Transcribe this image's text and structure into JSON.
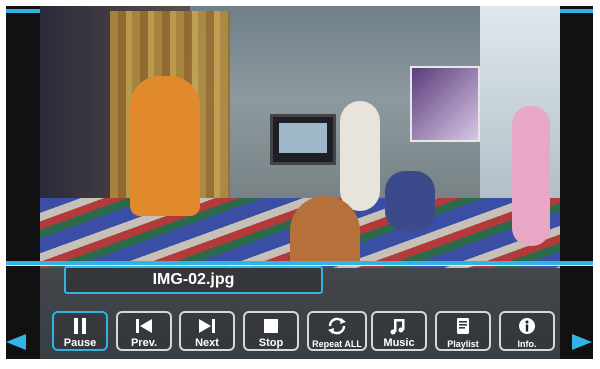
{
  "viewer": {
    "filename": "IMG-02.jpg"
  },
  "controls": [
    {
      "id": "pause",
      "label": "Pause",
      "icon": "pause-icon",
      "active": true
    },
    {
      "id": "prev",
      "label": "Prev.",
      "icon": "previous-icon",
      "active": false
    },
    {
      "id": "next",
      "label": "Next",
      "icon": "next-icon",
      "active": false
    },
    {
      "id": "stop",
      "label": "Stop",
      "icon": "stop-icon",
      "active": false
    },
    {
      "id": "repeat",
      "label": "Repeat ALL",
      "icon": "repeat-icon",
      "active": false
    },
    {
      "id": "music",
      "label": "Music",
      "icon": "music-note-icon",
      "active": false
    },
    {
      "id": "playlist",
      "label": "Playlist",
      "icon": "playlist-icon",
      "active": false
    },
    {
      "id": "info",
      "label": "Info.",
      "icon": "info-icon",
      "active": false
    }
  ],
  "colors": {
    "accent": "#33b3e4",
    "button_border": "#d7d7d7",
    "text": "#ffffff"
  }
}
